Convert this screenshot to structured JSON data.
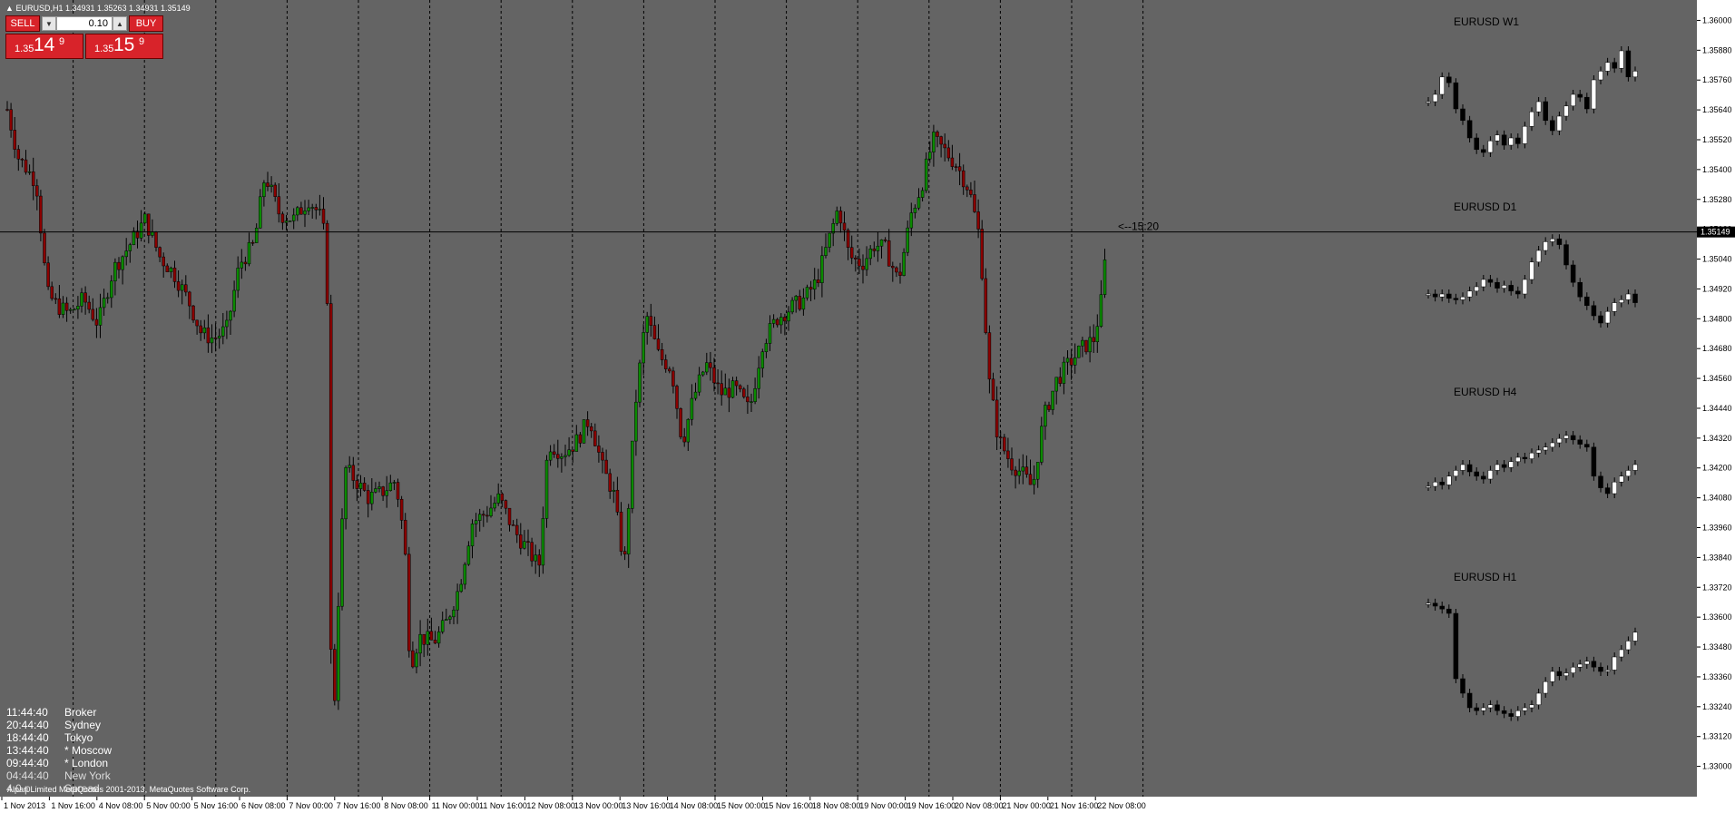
{
  "window": {
    "title_line": "EURUSD,H1  1.34931 1.35263 1.34931 1.35149"
  },
  "trade_panel": {
    "sell_label": "SELL",
    "buy_label": "BUY",
    "lot_value": "0.10",
    "sell_quote": {
      "small": "1.35",
      "big": "14",
      "sup": "9"
    },
    "buy_quote": {
      "small": "1.35",
      "big": "15",
      "sup": "9"
    }
  },
  "chart_data": {
    "type": "candlestick",
    "symbol": "EURUSD",
    "timeframe": "H1",
    "ylim": [
      1.329,
      1.3606
    ],
    "y_ticks": [
      "1.36000",
      "1.35880",
      "1.35760",
      "1.35640",
      "1.35520",
      "1.35400",
      "1.35280",
      "1.35160",
      "1.35040",
      "1.34920",
      "1.34800",
      "1.34680",
      "1.34560",
      "1.34440",
      "1.34320",
      "1.34200",
      "1.34080",
      "1.33960",
      "1.33840",
      "1.33720",
      "1.33600",
      "1.33480",
      "1.33360",
      "1.33240",
      "1.33120",
      "1.33000"
    ],
    "current_price": "1.35149",
    "countdown_label": "<--15:20",
    "x_ticks": [
      "1 Nov 2013",
      "1 Nov 16:00",
      "4 Nov 08:00",
      "5 Nov 00:00",
      "5 Nov 16:00",
      "6 Nov 08:00",
      "7 Nov 00:00",
      "7 Nov 16:00",
      "8 Nov 08:00",
      "11 Nov 00:00",
      "11 Nov 16:00",
      "12 Nov 08:00",
      "13 Nov 00:00",
      "13 Nov 16:00",
      "14 Nov 08:00",
      "15 Nov 00:00",
      "15 Nov 16:00",
      "18 Nov 08:00",
      "19 Nov 00:00",
      "19 Nov 16:00",
      "20 Nov 08:00",
      "21 Nov 00:00",
      "21 Nov 16:00",
      "22 Nov 08:00"
    ],
    "close_path": [
      [
        0,
        1.3577
      ],
      [
        20,
        1.3545
      ],
      [
        40,
        1.3535
      ],
      [
        52,
        1.349
      ],
      [
        64,
        1.3485
      ],
      [
        76,
        1.3482
      ],
      [
        92,
        1.3488
      ],
      [
        108,
        1.3478
      ],
      [
        125,
        1.35
      ],
      [
        140,
        1.3508
      ],
      [
        160,
        1.352
      ],
      [
        176,
        1.3505
      ],
      [
        192,
        1.3498
      ],
      [
        208,
        1.3487
      ],
      [
        222,
        1.3474
      ],
      [
        236,
        1.3472
      ],
      [
        250,
        1.3476
      ],
      [
        264,
        1.3502
      ],
      [
        280,
        1.351
      ],
      [
        292,
        1.3538
      ],
      [
        308,
        1.3522
      ],
      [
        324,
        1.352
      ],
      [
        340,
        1.3528
      ],
      [
        352,
        1.3522
      ],
      [
        360,
        1.351
      ],
      [
        366,
        1.33
      ],
      [
        372,
        1.336
      ],
      [
        380,
        1.342
      ],
      [
        392,
        1.3415
      ],
      [
        406,
        1.3408
      ],
      [
        420,
        1.341
      ],
      [
        436,
        1.3415
      ],
      [
        446,
        1.339
      ],
      [
        452,
        1.334
      ],
      [
        462,
        1.3352
      ],
      [
        478,
        1.335
      ],
      [
        492,
        1.3358
      ],
      [
        506,
        1.3372
      ],
      [
        520,
        1.3398
      ],
      [
        536,
        1.3402
      ],
      [
        550,
        1.3408
      ],
      [
        566,
        1.3395
      ],
      [
        580,
        1.3388
      ],
      [
        594,
        1.338
      ],
      [
        604,
        1.343
      ],
      [
        620,
        1.3426
      ],
      [
        634,
        1.343
      ],
      [
        650,
        1.344
      ],
      [
        664,
        1.342
      ],
      [
        676,
        1.341
      ],
      [
        688,
        1.338
      ],
      [
        700,
        1.3445
      ],
      [
        712,
        1.3482
      ],
      [
        726,
        1.3465
      ],
      [
        740,
        1.346
      ],
      [
        752,
        1.343
      ],
      [
        764,
        1.3448
      ],
      [
        778,
        1.3462
      ],
      [
        794,
        1.345
      ],
      [
        810,
        1.3452
      ],
      [
        826,
        1.3443
      ],
      [
        840,
        1.347
      ],
      [
        856,
        1.348
      ],
      [
        870,
        1.3484
      ],
      [
        886,
        1.3488
      ],
      [
        900,
        1.3495
      ],
      [
        912,
        1.351
      ],
      [
        924,
        1.3525
      ],
      [
        936,
        1.3505
      ],
      [
        950,
        1.3502
      ],
      [
        964,
        1.351
      ],
      [
        976,
        1.3508
      ],
      [
        990,
        1.3495
      ],
      [
        1004,
        1.3522
      ],
      [
        1016,
        1.3534
      ],
      [
        1028,
        1.3552
      ],
      [
        1040,
        1.3548
      ],
      [
        1054,
        1.3542
      ],
      [
        1068,
        1.3532
      ],
      [
        1080,
        1.3512
      ],
      [
        1090,
        1.3455
      ],
      [
        1100,
        1.3432
      ],
      [
        1114,
        1.3422
      ],
      [
        1126,
        1.3418
      ],
      [
        1138,
        1.3412
      ],
      [
        1150,
        1.344
      ],
      [
        1164,
        1.3455
      ],
      [
        1178,
        1.3462
      ],
      [
        1192,
        1.3468
      ],
      [
        1206,
        1.3472
      ],
      [
        1214,
        1.3488
      ],
      [
        1220,
        1.3512
      ],
      [
        1222,
        1.3515
      ]
    ],
    "mini_charts": [
      {
        "title": "EURUSD  W1",
        "values": [
          0.55,
          0.6,
          0.72,
          0.68,
          0.5,
          0.42,
          0.3,
          0.22,
          0.2,
          0.28,
          0.32,
          0.25,
          0.3,
          0.26,
          0.38,
          0.48,
          0.55,
          0.42,
          0.35,
          0.45,
          0.52,
          0.6,
          0.58,
          0.5,
          0.7,
          0.76,
          0.82,
          0.78,
          0.9,
          0.72,
          0.76
        ]
      },
      {
        "title": "EURUSD  D1",
        "values": [
          0.5,
          0.48,
          0.5,
          0.47,
          0.46,
          0.48,
          0.52,
          0.55,
          0.6,
          0.58,
          0.54,
          0.56,
          0.52,
          0.5,
          0.6,
          0.72,
          0.8,
          0.86,
          0.88,
          0.84,
          0.7,
          0.58,
          0.48,
          0.42,
          0.35,
          0.3,
          0.38,
          0.44,
          0.46,
          0.5,
          0.44
        ]
      },
      {
        "title": "EURUSD  H4",
        "values": [
          0.45,
          0.48,
          0.46,
          0.52,
          0.56,
          0.6,
          0.55,
          0.52,
          0.5,
          0.56,
          0.6,
          0.58,
          0.62,
          0.65,
          0.64,
          0.68,
          0.7,
          0.72,
          0.75,
          0.78,
          0.8,
          0.77,
          0.74,
          0.72,
          0.52,
          0.44,
          0.4,
          0.48,
          0.52,
          0.56,
          0.6
        ]
      },
      {
        "title": "EURUSD  H1",
        "values": [
          0.92,
          0.9,
          0.88,
          0.85,
          0.4,
          0.3,
          0.2,
          0.18,
          0.2,
          0.22,
          0.18,
          0.16,
          0.14,
          0.18,
          0.2,
          0.22,
          0.3,
          0.38,
          0.45,
          0.42,
          0.44,
          0.48,
          0.5,
          0.52,
          0.48,
          0.45,
          0.46,
          0.55,
          0.6,
          0.66,
          0.72
        ]
      }
    ]
  },
  "clock_panel": [
    {
      "time": "11:44:40",
      "city": "Broker",
      "muted": false
    },
    {
      "time": "20:44:40",
      "city": "Sydney",
      "muted": false
    },
    {
      "time": "18:44:40",
      "city": "Tokyo",
      "muted": false
    },
    {
      "time": "13:44:40",
      "city": "* Moscow",
      "muted": false
    },
    {
      "time": "09:44:40",
      "city": "* London",
      "muted": false
    },
    {
      "time": "04:44:40",
      "city": "New York",
      "muted": true
    },
    {
      "time": "4.0 p",
      "city": "Spread",
      "muted": true
    }
  ],
  "copyright": "Alpari Limited MetaQuotes 2001-2013, MetaQuotes Software Corp.",
  "colors": {
    "background": "#646464",
    "bull_body": "#0a8a00",
    "bear_body": "#8a0000",
    "candle_wick": "#000000",
    "mini_bull": "#ffffff",
    "mini_bear": "#000000",
    "grid": "#000000",
    "axis_bg": "#ffffff",
    "price_label_bg": "#000000",
    "price_label_fg": "#ffffff",
    "sell_buy_red": "#d8232a"
  }
}
